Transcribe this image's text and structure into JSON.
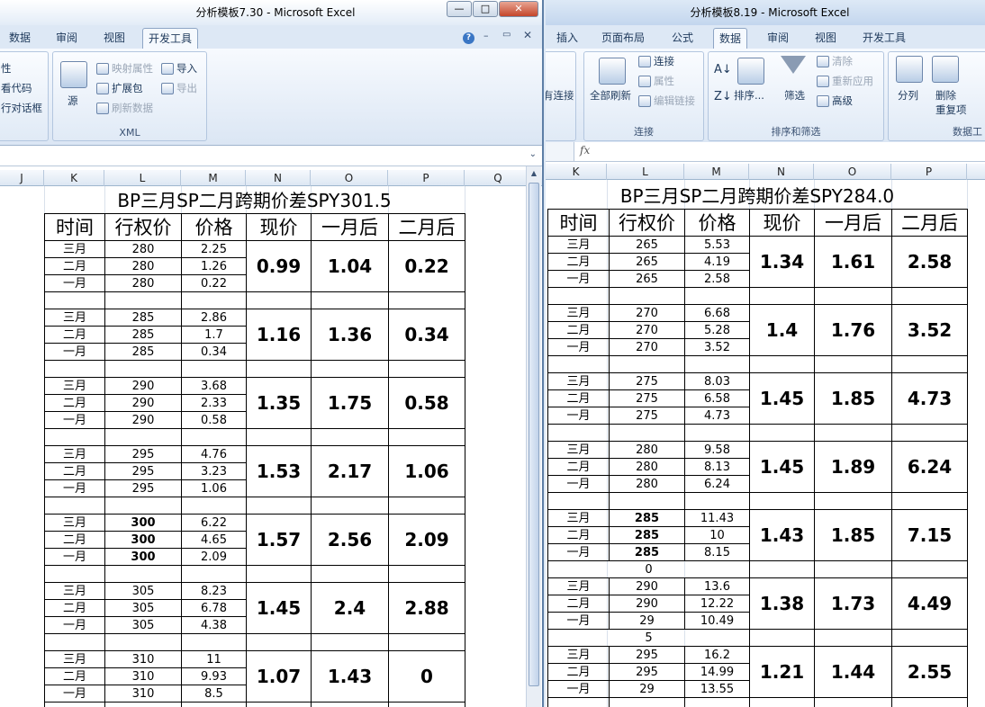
{
  "left": {
    "title": "分析模板7.30 - Microsoft Excel",
    "tabs": [
      "数据",
      "审阅",
      "视图",
      "开发工具"
    ],
    "ribbon": {
      "partial_items": [
        "性",
        "看代码",
        "行对话框"
      ],
      "xml": {
        "source": "源",
        "map_props": "映射属性",
        "expansion": "扩展包",
        "refresh": "刷新数据",
        "import": "导入",
        "export": "导出",
        "group": "XML"
      }
    },
    "columns": [
      "J",
      "K",
      "L",
      "M",
      "N",
      "O",
      "P",
      "Q"
    ],
    "sheet_title": "BP三月SP二月跨期价差SPY301.5",
    "headers": [
      "时间",
      "行权价",
      "价格",
      "现价",
      "一月后",
      "二月后"
    ],
    "blocks": [
      {
        "rows": [
          [
            "三月",
            "280",
            "2.25"
          ],
          [
            "二月",
            "280",
            "1.26"
          ],
          [
            "一月",
            "280",
            "0.22"
          ]
        ],
        "now": "0.99",
        "m1": "1.04",
        "m2": "0.22"
      },
      {
        "rows": [
          [
            "三月",
            "285",
            "2.86"
          ],
          [
            "二月",
            "285",
            "1.7"
          ],
          [
            "一月",
            "285",
            "0.34"
          ]
        ],
        "now": "1.16",
        "m1": "1.36",
        "m2": "0.34"
      },
      {
        "rows": [
          [
            "三月",
            "290",
            "3.68"
          ],
          [
            "二月",
            "290",
            "2.33"
          ],
          [
            "一月",
            "290",
            "0.58"
          ]
        ],
        "now": "1.35",
        "m1": "1.75",
        "m2": "0.58"
      },
      {
        "rows": [
          [
            "三月",
            "295",
            "4.76"
          ],
          [
            "二月",
            "295",
            "3.23"
          ],
          [
            "一月",
            "295",
            "1.06"
          ]
        ],
        "now": "1.53",
        "m1": "2.17",
        "m2": "1.06"
      },
      {
        "rows": [
          [
            "三月",
            "300",
            "6.22"
          ],
          [
            "二月",
            "300",
            "4.65"
          ],
          [
            "一月",
            "300",
            "2.09"
          ]
        ],
        "now": "1.57",
        "m1": "2.56",
        "m2": "2.09",
        "bold_strike": true
      },
      {
        "rows": [
          [
            "三月",
            "305",
            "8.23"
          ],
          [
            "二月",
            "305",
            "6.78"
          ],
          [
            "一月",
            "305",
            "4.38"
          ]
        ],
        "now": "1.45",
        "m1": "2.4",
        "m2": "2.88"
      },
      {
        "rows": [
          [
            "三月",
            "310",
            "11"
          ],
          [
            "二月",
            "310",
            "9.93"
          ],
          [
            "一月",
            "310",
            "8.5"
          ]
        ],
        "now": "1.07",
        "m1": "1.43",
        "m2": "0"
      }
    ]
  },
  "right": {
    "title": "分析模板8.19 - Microsoft Excel",
    "tabs": [
      "插入",
      "页面布局",
      "公式",
      "数据",
      "审阅",
      "视图",
      "开发工具"
    ],
    "ribbon": {
      "partial_conn": "有连接",
      "refresh_all": "全部刷新",
      "connections": "连接",
      "properties": "属性",
      "edit_links": "编辑链接",
      "group_conn": "连接",
      "sort": "排序...",
      "filter": "筛选",
      "clear": "清除",
      "reapply": "重新应用",
      "advanced": "高级",
      "group_sort": "排序和筛选",
      "split": "分列",
      "remove_dup_1": "删除",
      "remove_dup_2": "重复项",
      "group_data": "数据工"
    },
    "fx": "fx",
    "columns": [
      "K",
      "L",
      "M",
      "N",
      "O",
      "P"
    ],
    "sheet_title": "BP三月SP二月跨期价差SPY284.0",
    "headers": [
      "时间",
      "行权价",
      "价格",
      "现价",
      "一月后",
      "二月后"
    ],
    "blocks": [
      {
        "rows": [
          [
            "三月",
            "265",
            "5.53"
          ],
          [
            "二月",
            "265",
            "4.19"
          ],
          [
            "一月",
            "265",
            "2.58"
          ]
        ],
        "now": "1.34",
        "m1": "1.61",
        "m2": "2.58",
        "gap": ""
      },
      {
        "rows": [
          [
            "三月",
            "270",
            "6.68"
          ],
          [
            "二月",
            "270",
            "5.28"
          ],
          [
            "一月",
            "270",
            "3.52"
          ]
        ],
        "now": "1.4",
        "m1": "1.76",
        "m2": "3.52",
        "gap": ""
      },
      {
        "rows": [
          [
            "三月",
            "275",
            "8.03"
          ],
          [
            "二月",
            "275",
            "6.58"
          ],
          [
            "一月",
            "275",
            "4.73"
          ]
        ],
        "now": "1.45",
        "m1": "1.85",
        "m2": "4.73",
        "gap": ""
      },
      {
        "rows": [
          [
            "三月",
            "280",
            "9.58"
          ],
          [
            "二月",
            "280",
            "8.13"
          ],
          [
            "一月",
            "280",
            "6.24"
          ]
        ],
        "now": "1.45",
        "m1": "1.89",
        "m2": "6.24",
        "gap": ""
      },
      {
        "rows": [
          [
            "三月",
            "285",
            "11.43"
          ],
          [
            "二月",
            "285",
            "10"
          ],
          [
            "一月",
            "285",
            "8.15"
          ]
        ],
        "now": "1.43",
        "m1": "1.85",
        "m2": "7.15",
        "gap": "0",
        "bold_strike": true
      },
      {
        "rows": [
          [
            "三月",
            "290",
            "13.6"
          ],
          [
            "二月",
            "290",
            "12.22"
          ],
          [
            "一月",
            "29",
            "10.49"
          ]
        ],
        "now": "1.38",
        "m1": "1.73",
        "m2": "4.49",
        "gap": "5"
      },
      {
        "rows": [
          [
            "三月",
            "295",
            "16.2"
          ],
          [
            "二月",
            "295",
            "14.99"
          ],
          [
            "一月",
            "29",
            "13.55"
          ]
        ],
        "now": "1.21",
        "m1": "1.44",
        "m2": "2.55",
        "gap": ""
      }
    ]
  }
}
